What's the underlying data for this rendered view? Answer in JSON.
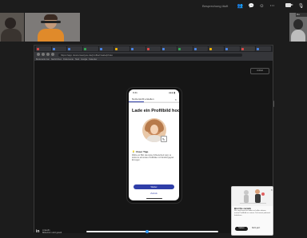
{
  "meeting": {
    "title": "Besprechung läuft"
  },
  "participants": [
    {
      "name": "Teilnehmer 1"
    },
    {
      "name": "Teilnehmer 2"
    },
    {
      "name": "Du"
    }
  ],
  "browser": {
    "url": "https://app.nicetomeetyou.de/profile/create/photo",
    "bookmarks": [
      "Bookmarks bar",
      "Nachrichten",
      "Dokumente",
      "Start",
      "Google",
      "Kalender"
    ],
    "fullscreen_label": "Vollbild"
  },
  "phone": {
    "time": "9:41",
    "signal": "●●● ▮",
    "progress_header": "Nutzerprofil erstellen",
    "progress_fraction": 0.3,
    "close": "×",
    "heading": "Lade ein Profilbild hoch",
    "edit_icon": "✎",
    "tip_title": "Unser Tipp",
    "tip_text": "Wähle ein Bild, das deine Zufriedenheit zeigt, so wirkst du auf andere Profilbilder mit Strahlungsgrad. Erzeugen.",
    "primary_button": "Weiter",
    "back_link": "Zurück"
  },
  "bottom_bar": {
    "logo": "in",
    "line1": "LinkedIn",
    "line2": "Bildschirm wird geteilt"
  },
  "popup": {
    "close": "×",
    "title": "Bist Du zurück",
    "text": "Wir sind bereit dir dabei zu helfen deinen ersten Profilbild zu setzen. Du kannst jederzeit fortfahren.",
    "button": "Starten",
    "link": "Nicht jetzt"
  },
  "colors": {
    "accent": "#2f3ea8",
    "background": "#1c1c1c"
  }
}
